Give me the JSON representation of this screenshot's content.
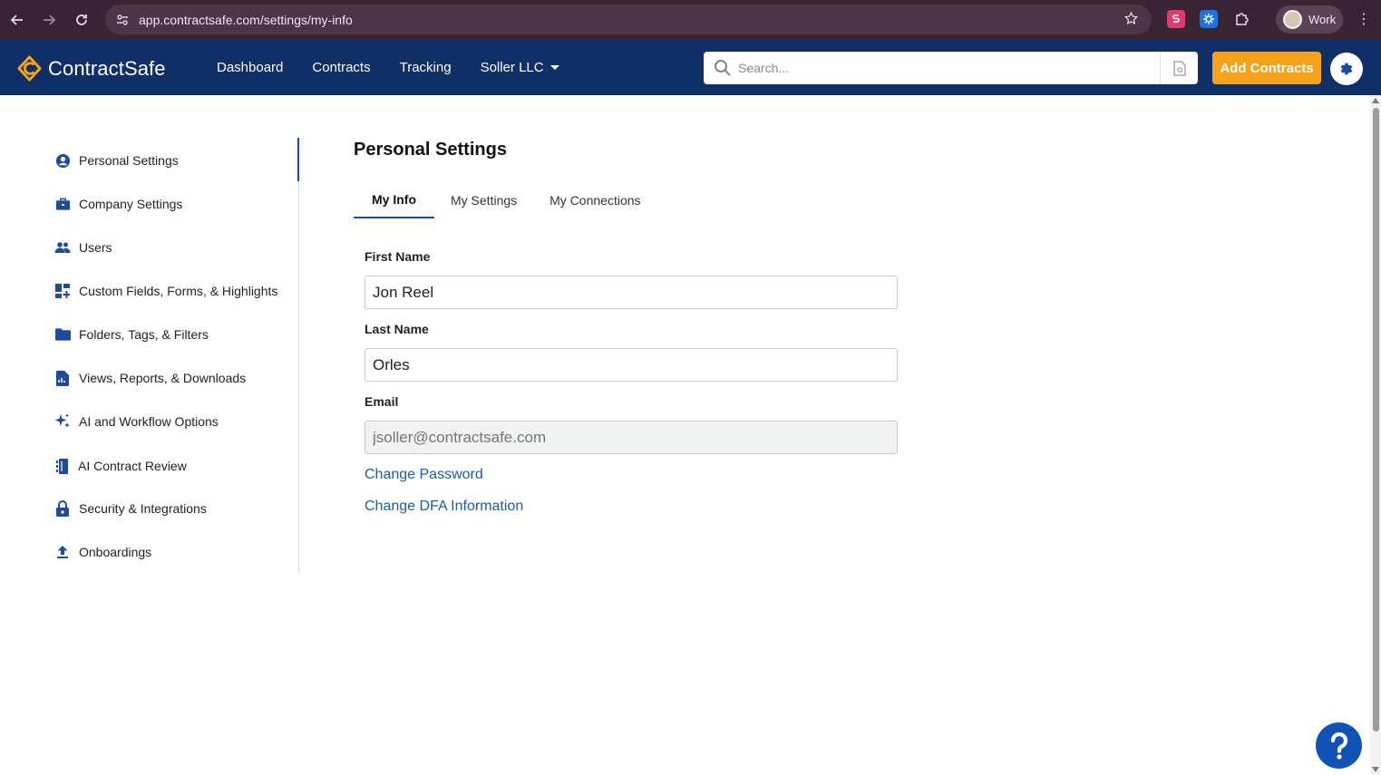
{
  "browser": {
    "url": "app.contractsafe.com/settings/my-info",
    "profile_name": "Work"
  },
  "header": {
    "brand": "ContractSafe",
    "nav": [
      "Dashboard",
      "Contracts",
      "Tracking",
      "Soller LLC"
    ],
    "search_placeholder": "Search...",
    "add_button": "Add Contracts"
  },
  "sidebar": {
    "items": [
      {
        "label": "Personal Settings",
        "icon": "account-circle-icon"
      },
      {
        "label": "Company Settings",
        "icon": "briefcase-icon"
      },
      {
        "label": "Users",
        "icon": "users-icon"
      },
      {
        "label": "Custom Fields, Forms, & Highlights",
        "icon": "dashboard-add-icon"
      },
      {
        "label": "Folders, Tags, & Filters",
        "icon": "folder-icon"
      },
      {
        "label": "Views, Reports, & Downloads",
        "icon": "report-icon"
      },
      {
        "label": "AI and Workflow Options",
        "icon": "sparkle-icon"
      },
      {
        "label": "AI Contract Review",
        "icon": "book-icon"
      },
      {
        "label": "Security & Integrations",
        "icon": "lock-icon"
      },
      {
        "label": "Onboardings",
        "icon": "upload-icon"
      }
    ],
    "active_index": 0
  },
  "main": {
    "title": "Personal Settings",
    "tabs": [
      "My Info",
      "My Settings",
      "My Connections"
    ],
    "active_tab": 0,
    "first_name_label": "First Name",
    "first_name_value": "Jon Reel",
    "last_name_label": "Last Name",
    "last_name_value": "Orles",
    "email_label": "Email",
    "email_placeholder": "jsoller@contractsafe.com",
    "change_password": "Change Password",
    "change_dfa": "Change DFA Information"
  },
  "colors": {
    "header_bg": "#0f2f66",
    "accent_orange": "#f7a21b",
    "link_blue": "#1d5aa8",
    "active_blue": "#1e4b9a",
    "browser_bg": "#3a2333"
  }
}
